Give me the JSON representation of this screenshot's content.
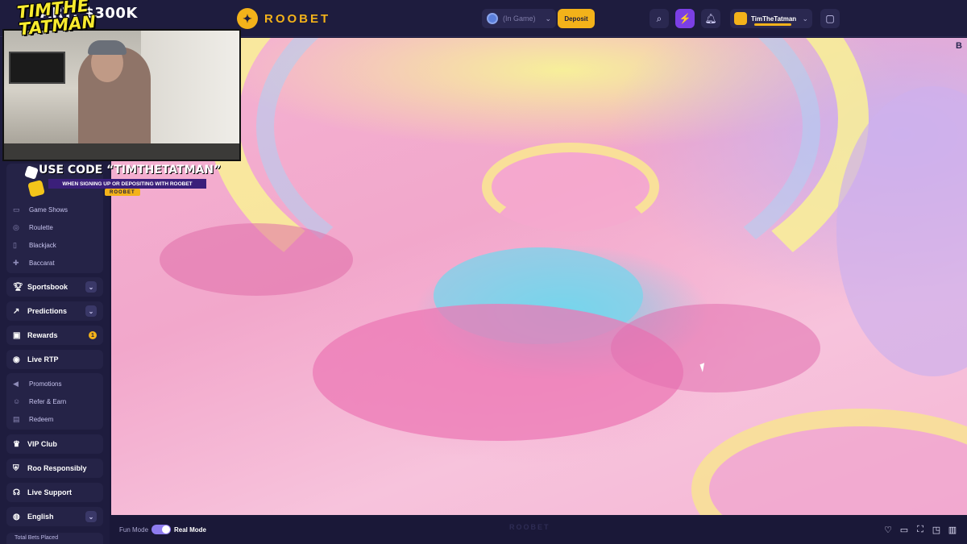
{
  "stream": {
    "streamer_logo": "TIMTHE TATMAN",
    "streak_text": "ART: $300K",
    "promo_code": "USE CODE “TIMTHETATMAN”",
    "promo_sub": "WHEN SIGNING UP OR DEPOSITING WITH ROOBET",
    "promo_tag": "ROOBET"
  },
  "header": {
    "logo_text": "ROOBET",
    "balance_label": "(In Game)",
    "deposit_label": "Deposit",
    "username": "TimTheTatman"
  },
  "sidebar": {
    "sub_items_top": [
      "Game Shows",
      "Roulette",
      "Blackjack",
      "Baccarat"
    ],
    "sportsbook": "Sportsbook",
    "predictions": "Predictions",
    "rewards": "Rewards",
    "rewards_badge": "1",
    "live_rtp": "Live RTP",
    "sub_items_mid": [
      "Promotions",
      "Refer & Earn",
      "Redeem"
    ],
    "vip_club": "VIP Club",
    "roo_responsibly": "Roo Responsibly",
    "live_support": "Live Support",
    "language": "English",
    "total_bets": "Total Bets Placed"
  },
  "game": {
    "corner_label": "B"
  },
  "footer": {
    "fun_mode": "Fun Mode",
    "real_mode": "Real Mode",
    "watermark": "ROOBET"
  },
  "colors": {
    "accent": "#f3b21a",
    "panel": "#1e1c3e",
    "toggle": "#8e7cf0"
  }
}
